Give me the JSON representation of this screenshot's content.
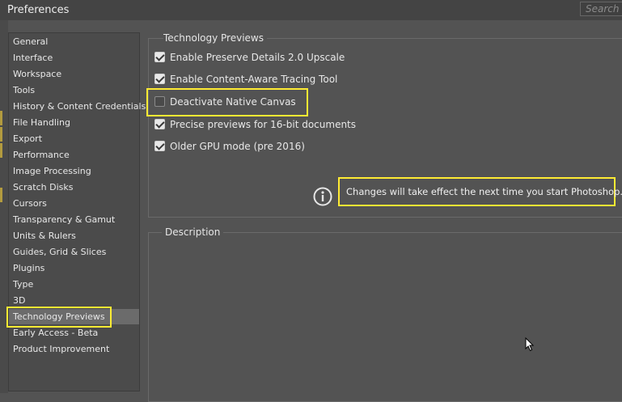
{
  "window": {
    "title": "Preferences",
    "search_placeholder": "Search P"
  },
  "sidebar": {
    "items": [
      {
        "label": "General"
      },
      {
        "label": "Interface"
      },
      {
        "label": "Workspace"
      },
      {
        "label": "Tools"
      },
      {
        "label": "History & Content Credentials"
      },
      {
        "label": "File Handling"
      },
      {
        "label": "Export"
      },
      {
        "label": "Performance"
      },
      {
        "label": "Image Processing"
      },
      {
        "label": "Scratch Disks"
      },
      {
        "label": "Cursors"
      },
      {
        "label": "Transparency & Gamut"
      },
      {
        "label": "Units & Rulers"
      },
      {
        "label": "Guides, Grid & Slices"
      },
      {
        "label": "Plugins"
      },
      {
        "label": "Type"
      },
      {
        "label": "3D"
      },
      {
        "label": "Technology Previews",
        "selected": true
      },
      {
        "label": "Early Access - Beta"
      },
      {
        "label": "Product Improvement"
      }
    ]
  },
  "technology_previews": {
    "title": "Technology Previews",
    "options": [
      {
        "label": "Enable Preserve Details 2.0 Upscale",
        "checked": true
      },
      {
        "label": "Enable Content-Aware Tracing Tool",
        "checked": true
      },
      {
        "label": "Deactivate Native Canvas",
        "checked": false
      },
      {
        "label": "Precise previews for 16-bit documents",
        "checked": true
      },
      {
        "label": "Older GPU mode (pre 2016)",
        "checked": true
      }
    ],
    "notice": "Changes will take effect the next time you start Photoshop."
  },
  "description": {
    "title": "Description"
  },
  "colors": {
    "highlight": "#ffeb33",
    "background": "#535353",
    "selected_item": "#6b6b6b"
  },
  "icons": {
    "info": "info-circle-icon",
    "cursor": "mouse-pointer-icon"
  }
}
